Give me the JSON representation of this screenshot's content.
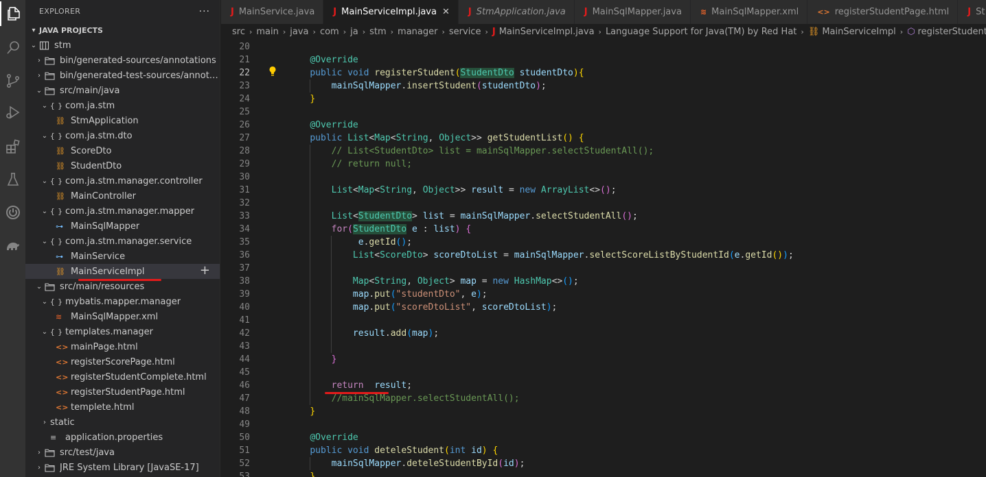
{
  "activity_bar": {
    "icons": [
      "explorer-icon",
      "search-icon",
      "source-control-icon",
      "run-debug-icon",
      "extensions-icon",
      "testing-icon",
      "spring-boot-icon",
      "gradle-icon"
    ]
  },
  "sidebar": {
    "title": "EXPLORER",
    "more": "···",
    "section": "JAVA PROJECTS",
    "tree": [
      {
        "label": "stm",
        "indent": 1,
        "chev": "v",
        "icon": "project"
      },
      {
        "label": "bin/generated-sources/annotations",
        "indent": 2,
        "chev": ">",
        "icon": "folder"
      },
      {
        "label": "bin/generated-test-sources/annotations",
        "indent": 2,
        "chev": ">",
        "icon": "folder"
      },
      {
        "label": "src/main/java",
        "indent": 2,
        "chev": "v",
        "icon": "folder"
      },
      {
        "label": "com.ja.stm",
        "indent": 3,
        "chev": "v",
        "icon": "package"
      },
      {
        "label": "StmApplication",
        "indent": 4,
        "chev": "",
        "icon": "class"
      },
      {
        "label": "com.ja.stm.dto",
        "indent": 3,
        "chev": "v",
        "icon": "package"
      },
      {
        "label": "ScoreDto",
        "indent": 4,
        "chev": "",
        "icon": "class"
      },
      {
        "label": "StudentDto",
        "indent": 4,
        "chev": "",
        "icon": "class"
      },
      {
        "label": "com.ja.stm.manager.controller",
        "indent": 3,
        "chev": "v",
        "icon": "package"
      },
      {
        "label": "MainController",
        "indent": 4,
        "chev": "",
        "icon": "class"
      },
      {
        "label": "com.ja.stm.manager.mapper",
        "indent": 3,
        "chev": "v",
        "icon": "package"
      },
      {
        "label": "MainSqlMapper",
        "indent": 4,
        "chev": "",
        "icon": "interface"
      },
      {
        "label": "com.ja.stm.manager.service",
        "indent": 3,
        "chev": "v",
        "icon": "package"
      },
      {
        "label": "MainService",
        "indent": 4,
        "chev": "",
        "icon": "interface"
      },
      {
        "label": "MainServiceImpl",
        "indent": 4,
        "chev": "",
        "icon": "class",
        "selected": true
      },
      {
        "label": "src/main/resources",
        "indent": 2,
        "chev": "v",
        "icon": "folder"
      },
      {
        "label": "mybatis.mapper.manager",
        "indent": 3,
        "chev": "v",
        "icon": "package"
      },
      {
        "label": "MainSqlMapper.xml",
        "indent": 4,
        "chev": "",
        "icon": "xml"
      },
      {
        "label": "templates.manager",
        "indent": 3,
        "chev": "v",
        "icon": "package"
      },
      {
        "label": "mainPage.html",
        "indent": 4,
        "chev": "",
        "icon": "html"
      },
      {
        "label": "registerScorePage.html",
        "indent": 4,
        "chev": "",
        "icon": "html"
      },
      {
        "label": "registerStudentComplete.html",
        "indent": 4,
        "chev": "",
        "icon": "html"
      },
      {
        "label": "registerStudentPage.html",
        "indent": 4,
        "chev": "",
        "icon": "html"
      },
      {
        "label": "templete.html",
        "indent": 4,
        "chev": "",
        "icon": "html"
      },
      {
        "label": "static",
        "indent": 3,
        "chev": ">",
        "icon": "none"
      },
      {
        "label": "application.properties",
        "indent": 3,
        "chev": "",
        "icon": "props"
      },
      {
        "label": "src/test/java",
        "indent": 2,
        "chev": ">",
        "icon": "folder"
      },
      {
        "label": "JRE System Library [JavaSE-17]",
        "indent": 2,
        "chev": ">",
        "icon": "folder"
      }
    ]
  },
  "tabs": [
    {
      "label": "MainService.java",
      "type": "java",
      "active": false,
      "italic": false
    },
    {
      "label": "MainServiceImpl.java",
      "type": "java",
      "active": true,
      "italic": false,
      "close": "✕"
    },
    {
      "label": "StmApplication.java",
      "type": "java",
      "active": false,
      "italic": true
    },
    {
      "label": "MainSqlMapper.java",
      "type": "java",
      "active": false,
      "italic": false
    },
    {
      "label": "MainSqlMapper.xml",
      "type": "xml",
      "active": false,
      "italic": false
    },
    {
      "label": "registerStudentPage.html",
      "type": "html",
      "active": false,
      "italic": false
    },
    {
      "label": "St",
      "type": "java",
      "active": false,
      "italic": false
    }
  ],
  "breadcrumb": [
    "src",
    "main",
    "java",
    "com",
    "ja",
    "stm",
    "manager",
    "service",
    "MainServiceImpl.java",
    "Language Support for Java(TM) by Red Hat",
    "MainServiceImpl",
    "registerStudent(StudentDto)"
  ],
  "editor": {
    "current_line": 22,
    "lines": [
      {
        "n": 20,
        "t": [
          [
            "pl",
            ""
          ]
        ]
      },
      {
        "n": 21,
        "t": [
          [
            "pl",
            "    "
          ],
          [
            "an",
            "@Override"
          ]
        ]
      },
      {
        "n": 22,
        "t": [
          [
            "pl",
            "    "
          ],
          [
            "kw",
            "public"
          ],
          [
            "pl",
            " "
          ],
          [
            "kw",
            "void"
          ],
          [
            "pl",
            " "
          ],
          [
            "fn",
            "registerStudent"
          ],
          [
            "br1",
            "("
          ],
          [
            "tyhl",
            "StudentDto"
          ],
          [
            "pl",
            " "
          ],
          [
            "va",
            "studentDto"
          ],
          [
            "br1",
            ")"
          ],
          [
            "br1",
            "{"
          ]
        ]
      },
      {
        "n": 23,
        "t": [
          [
            "pl",
            "        "
          ],
          [
            "va",
            "mainSqlMapper"
          ],
          [
            "pl",
            "."
          ],
          [
            "fn",
            "insertStudent"
          ],
          [
            "br2",
            "("
          ],
          [
            "va",
            "studentDto"
          ],
          [
            "br2",
            ")"
          ],
          [
            "pl",
            ";"
          ]
        ]
      },
      {
        "n": 24,
        "t": [
          [
            "pl",
            "    "
          ],
          [
            "br1",
            "}"
          ]
        ]
      },
      {
        "n": 25,
        "t": [
          [
            "pl",
            ""
          ]
        ]
      },
      {
        "n": 26,
        "t": [
          [
            "pl",
            "    "
          ],
          [
            "an",
            "@Override"
          ]
        ]
      },
      {
        "n": 27,
        "t": [
          [
            "pl",
            "    "
          ],
          [
            "kw",
            "public"
          ],
          [
            "pl",
            " "
          ],
          [
            "ty",
            "List"
          ],
          [
            "pl",
            "<"
          ],
          [
            "ty",
            "Map"
          ],
          [
            "pl",
            "<"
          ],
          [
            "ty",
            "String"
          ],
          [
            "pl",
            ", "
          ],
          [
            "ty",
            "Object"
          ],
          [
            "pl",
            ">> "
          ],
          [
            "fn",
            "getStudentList"
          ],
          [
            "br1",
            "()"
          ],
          [
            "pl",
            " "
          ],
          [
            "br1",
            "{"
          ]
        ]
      },
      {
        "n": 28,
        "t": [
          [
            "pl",
            "        "
          ],
          [
            "cm",
            "// List<StudentDto> list = mainSqlMapper.selectStudentAll();"
          ]
        ]
      },
      {
        "n": 29,
        "t": [
          [
            "pl",
            "        "
          ],
          [
            "cm",
            "// return null;"
          ]
        ]
      },
      {
        "n": 30,
        "t": [
          [
            "pl",
            ""
          ]
        ]
      },
      {
        "n": 31,
        "t": [
          [
            "pl",
            "        "
          ],
          [
            "ty",
            "List"
          ],
          [
            "pl",
            "<"
          ],
          [
            "ty",
            "Map"
          ],
          [
            "pl",
            "<"
          ],
          [
            "ty",
            "String"
          ],
          [
            "pl",
            ", "
          ],
          [
            "ty",
            "Object"
          ],
          [
            "pl",
            ">> "
          ],
          [
            "va",
            "result"
          ],
          [
            "pl",
            " = "
          ],
          [
            "kw",
            "new"
          ],
          [
            "pl",
            " "
          ],
          [
            "ty",
            "ArrayList"
          ],
          [
            "pl",
            "<>"
          ],
          [
            "br2",
            "()"
          ],
          [
            "pl",
            ";"
          ]
        ]
      },
      {
        "n": 32,
        "t": [
          [
            "pl",
            ""
          ]
        ]
      },
      {
        "n": 33,
        "t": [
          [
            "pl",
            "        "
          ],
          [
            "ty",
            "List"
          ],
          [
            "pl",
            "<"
          ],
          [
            "tyhl",
            "StudentDto"
          ],
          [
            "pl",
            "> "
          ],
          [
            "va",
            "list"
          ],
          [
            "pl",
            " = "
          ],
          [
            "va",
            "mainSqlMapper"
          ],
          [
            "pl",
            "."
          ],
          [
            "fn",
            "selectStudentAll"
          ],
          [
            "br2",
            "()"
          ],
          [
            "pl",
            ";"
          ]
        ]
      },
      {
        "n": 34,
        "t": [
          [
            "pl",
            "        "
          ],
          [
            "ctl",
            "for"
          ],
          [
            "br2",
            "("
          ],
          [
            "tyhl",
            "StudentDto"
          ],
          [
            "pl",
            " "
          ],
          [
            "va",
            "e"
          ],
          [
            "pl",
            " : "
          ],
          [
            "va",
            "list"
          ],
          [
            "br2",
            ")"
          ],
          [
            "pl",
            " "
          ],
          [
            "br2",
            "{"
          ]
        ]
      },
      {
        "n": 35,
        "t": [
          [
            "pl",
            "             "
          ],
          [
            "va",
            "e"
          ],
          [
            "pl",
            "."
          ],
          [
            "fn",
            "getId"
          ],
          [
            "br3",
            "()"
          ],
          [
            "pl",
            ";"
          ]
        ]
      },
      {
        "n": 36,
        "t": [
          [
            "pl",
            "            "
          ],
          [
            "ty",
            "List"
          ],
          [
            "pl",
            "<"
          ],
          [
            "ty",
            "ScoreDto"
          ],
          [
            "pl",
            "> "
          ],
          [
            "va",
            "scoreDtoList"
          ],
          [
            "pl",
            " = "
          ],
          [
            "va",
            "mainSqlMapper"
          ],
          [
            "pl",
            "."
          ],
          [
            "fn",
            "selectScoreListByStudentId"
          ],
          [
            "br3",
            "("
          ],
          [
            "va",
            "e"
          ],
          [
            "pl",
            "."
          ],
          [
            "fn",
            "getId"
          ],
          [
            "br1",
            "()"
          ],
          [
            "br3",
            ")"
          ],
          [
            "pl",
            ";"
          ]
        ]
      },
      {
        "n": 37,
        "t": [
          [
            "pl",
            ""
          ]
        ]
      },
      {
        "n": 38,
        "t": [
          [
            "pl",
            "            "
          ],
          [
            "ty",
            "Map"
          ],
          [
            "pl",
            "<"
          ],
          [
            "ty",
            "String"
          ],
          [
            "pl",
            ", "
          ],
          [
            "ty",
            "Object"
          ],
          [
            "pl",
            "> "
          ],
          [
            "va",
            "map"
          ],
          [
            "pl",
            " = "
          ],
          [
            "kw",
            "new"
          ],
          [
            "pl",
            " "
          ],
          [
            "ty",
            "HashMap"
          ],
          [
            "pl",
            "<>"
          ],
          [
            "br3",
            "()"
          ],
          [
            "pl",
            ";"
          ]
        ]
      },
      {
        "n": 39,
        "t": [
          [
            "pl",
            "            "
          ],
          [
            "va",
            "map"
          ],
          [
            "pl",
            "."
          ],
          [
            "fn",
            "put"
          ],
          [
            "br3",
            "("
          ],
          [
            "st",
            "\"studentDto\""
          ],
          [
            "pl",
            ", "
          ],
          [
            "va",
            "e"
          ],
          [
            "br3",
            ")"
          ],
          [
            "pl",
            ";"
          ]
        ]
      },
      {
        "n": 40,
        "t": [
          [
            "pl",
            "            "
          ],
          [
            "va",
            "map"
          ],
          [
            "pl",
            "."
          ],
          [
            "fn",
            "put"
          ],
          [
            "br3",
            "("
          ],
          [
            "st",
            "\"scoreDtoList\""
          ],
          [
            "pl",
            ", "
          ],
          [
            "va",
            "scoreDtoList"
          ],
          [
            "br3",
            ")"
          ],
          [
            "pl",
            ";"
          ]
        ]
      },
      {
        "n": 41,
        "t": [
          [
            "pl",
            ""
          ]
        ]
      },
      {
        "n": 42,
        "t": [
          [
            "pl",
            "            "
          ],
          [
            "va",
            "result"
          ],
          [
            "pl",
            "."
          ],
          [
            "fn",
            "add"
          ],
          [
            "br3",
            "("
          ],
          [
            "va",
            "map"
          ],
          [
            "br3",
            ")"
          ],
          [
            "pl",
            ";"
          ]
        ]
      },
      {
        "n": 43,
        "t": [
          [
            "pl",
            ""
          ]
        ]
      },
      {
        "n": 44,
        "t": [
          [
            "pl",
            "        "
          ],
          [
            "br2",
            "}"
          ]
        ]
      },
      {
        "n": 45,
        "t": [
          [
            "pl",
            ""
          ]
        ]
      },
      {
        "n": 46,
        "t": [
          [
            "pl",
            "        "
          ],
          [
            "ctl",
            "return"
          ],
          [
            "pl",
            "  "
          ],
          [
            "va",
            "result"
          ],
          [
            "pl",
            ";"
          ]
        ]
      },
      {
        "n": 47,
        "t": [
          [
            "pl",
            "        "
          ],
          [
            "cm",
            "//mainSqlMapper.selectStudentAll();"
          ]
        ]
      },
      {
        "n": 48,
        "t": [
          [
            "pl",
            "    "
          ],
          [
            "br1",
            "}"
          ]
        ]
      },
      {
        "n": 49,
        "t": [
          [
            "pl",
            ""
          ]
        ]
      },
      {
        "n": 50,
        "t": [
          [
            "pl",
            "    "
          ],
          [
            "an",
            "@Override"
          ]
        ]
      },
      {
        "n": 51,
        "t": [
          [
            "pl",
            "    "
          ],
          [
            "kw",
            "public"
          ],
          [
            "pl",
            " "
          ],
          [
            "kw",
            "void"
          ],
          [
            "pl",
            " "
          ],
          [
            "fn",
            "deteleStudent"
          ],
          [
            "br1",
            "("
          ],
          [
            "kw",
            "int"
          ],
          [
            "pl",
            " "
          ],
          [
            "va",
            "id"
          ],
          [
            "br1",
            ")"
          ],
          [
            "pl",
            " "
          ],
          [
            "br1",
            "{"
          ]
        ]
      },
      {
        "n": 52,
        "t": [
          [
            "pl",
            "        "
          ],
          [
            "va",
            "mainSqlMapper"
          ],
          [
            "pl",
            "."
          ],
          [
            "fn",
            "deteleStudentById"
          ],
          [
            "br2",
            "("
          ],
          [
            "va",
            "id"
          ],
          [
            "br2",
            ")"
          ],
          [
            "pl",
            ";"
          ]
        ]
      },
      {
        "n": 53,
        "t": [
          [
            "pl",
            "    "
          ],
          [
            "br1",
            "}"
          ]
        ]
      }
    ]
  },
  "colors": {
    "annotation_underline": "#e51b1b",
    "editor_bg": "#1e1e1e",
    "sidebar_bg": "#252526",
    "activity_bg": "#333333"
  }
}
